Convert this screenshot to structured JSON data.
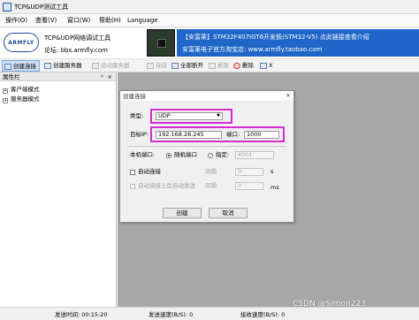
{
  "window": {
    "title": "TCP&UDP测试工具"
  },
  "menu": [
    "操作(O)",
    "查看(V)",
    "窗口(W)",
    "帮助(H)",
    "Language"
  ],
  "banner": {
    "logo_text": "ARMFLY",
    "app_name": "TCP&UDP网络调试工具",
    "forum": "论坛: bbs.armfly.com",
    "promo_line1": "【安富莱】STM32F407IGT6开发板(STM32-V5) 点此链接查看介绍",
    "promo_line2": "安富莱电子官方淘宝店: www.armfly.taobao.com"
  },
  "toolbar": {
    "create_conn": "创建连接",
    "create_server": "创建服务器",
    "start_server": "启动服务器",
    "connect": "连接",
    "disconnect": "全部断开",
    "delete": "删除",
    "remove": "删除",
    "close": "X"
  },
  "sidebar": {
    "title": "属性栏",
    "pin": "ᵖ",
    "close": "×",
    "items": [
      "客户端模式",
      "服务器模式"
    ]
  },
  "dialog": {
    "title": "创建连接",
    "close": "×",
    "type_label": "类型:",
    "type_value": "UDP",
    "ip_label": "目标IP:",
    "ip_value": "192.168.28.245",
    "port_label": "端口:",
    "port_value": "1000",
    "local_port_label": "本机端口:",
    "random_port": "随机端口",
    "specify": "指定:",
    "local_port_value": "4001",
    "auto_connect": "自动连接",
    "interval_label": "间隔",
    "interval_value": "0",
    "interval_unit": "s",
    "auto_send": "自动连接上后自动发送",
    "send_interval_label": "间隔",
    "send_interval_value": "0",
    "send_interval_unit": "ms",
    "ok": "创建",
    "cancel": "取消"
  },
  "status": {
    "send_time": "发送时间: 00:15:20",
    "send_speed": "发送速度(B/S): 0",
    "recv_speed": "接收速度(B/S): 0"
  },
  "watermark": "CSDN @Simon223",
  "colors": {
    "highlight": "#d62ad0",
    "promo_bg": "#1f66c9",
    "work_area": "#a7a7a7"
  }
}
